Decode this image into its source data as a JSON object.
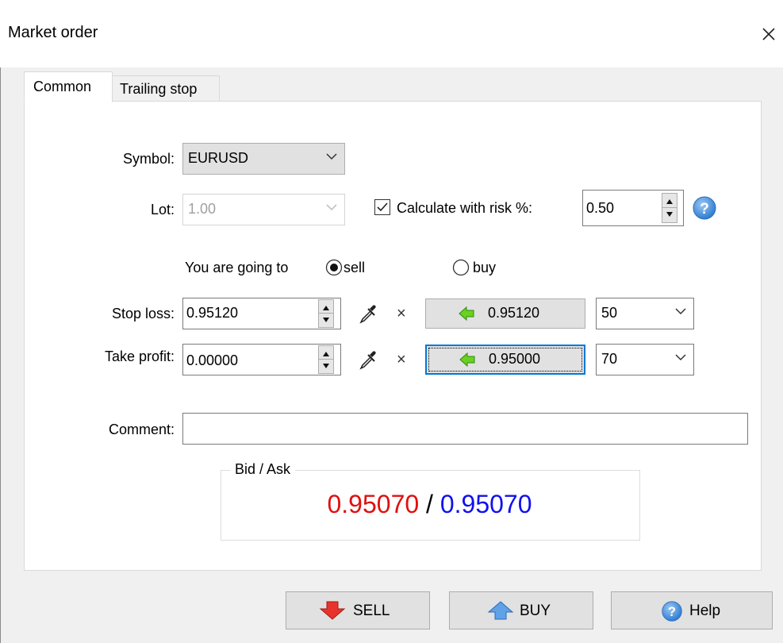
{
  "window": {
    "title": "Market order"
  },
  "tabs": [
    {
      "label": "Common"
    },
    {
      "label": "Trailing stop"
    }
  ],
  "form": {
    "symbol_label": "Symbol:",
    "symbol_value": "EURUSD",
    "lot_label": "Lot:",
    "lot_value": "1.00",
    "risk_checkbox_label": "Calculate with risk %:",
    "risk_checked": true,
    "risk_value": "0.50",
    "direction_label": "You are going to",
    "direction_options": [
      "sell",
      "buy"
    ],
    "direction_selected": "sell",
    "stop_loss_label": "Stop loss:",
    "stop_loss_value": "0.95120",
    "stop_loss_button_value": "0.95120",
    "stop_loss_points": "50",
    "take_profit_label": "Take profit:",
    "take_profit_value": "0.00000",
    "take_profit_button_value": "0.95000",
    "take_profit_points": "70",
    "clear_symbol": "×",
    "comment_label": "Comment:",
    "comment_value": ""
  },
  "bid_ask": {
    "legend": "Bid / Ask",
    "bid": "0.95070",
    "separator": " / ",
    "ask": "0.95070",
    "bid_color": "#e01010",
    "ask_color": "#1010f0"
  },
  "buttons": {
    "sell": "SELL",
    "buy": "BUY",
    "help": "Help"
  },
  "icons": [
    "close-icon",
    "chevron-down-icon",
    "help-icon",
    "eyedropper-icon",
    "arrow-left-icon",
    "arrow-down-icon",
    "arrow-up-icon"
  ]
}
